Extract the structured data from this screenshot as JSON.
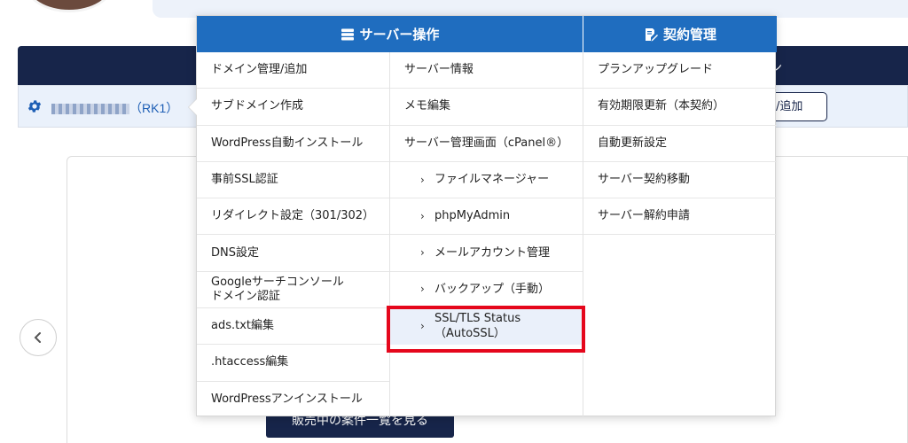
{
  "background": {
    "server_label_suffix": "（RK1）",
    "add_button_label": "追加",
    "dark_bar_right_text": "ン",
    "list_button_label": "販売中の案件一覧を見る"
  },
  "menu": {
    "server_ops_header": "サーバー操作",
    "contract_header": "契約管理",
    "col_a": [
      "ドメイン管理/追加",
      "サブドメイン作成",
      "WordPress自動インストール",
      "事前SSL認証",
      "リダイレクト設定（301/302）",
      "DNS設定",
      "Googleサーチコンソール\nドメイン認証",
      "ads.txt編集",
      ".htaccess編集",
      "WordPressアンインストール"
    ],
    "col_b": {
      "server_info": "サーバー情報",
      "memo_edit": "メモ編集",
      "cpanel": "サーバー管理画面（cPanel®）",
      "file_manager": "ファイルマネージャー",
      "phpmyadmin": "phpMyAdmin",
      "mail_accounts": "メールアカウント管理",
      "backup": "バックアップ（手動）",
      "ssl_status_line1": "SSL/TLS Status",
      "ssl_status_line2": "（AutoSSL）"
    },
    "col_c": [
      "プランアップグレード",
      "有効期限更新（本契約）",
      "自動更新設定",
      "サーバー契約移動",
      "サーバー解約申請"
    ]
  },
  "colors": {
    "header_blue": "#1f6dbf",
    "navy": "#17254a",
    "highlight_red": "#e5071c"
  }
}
